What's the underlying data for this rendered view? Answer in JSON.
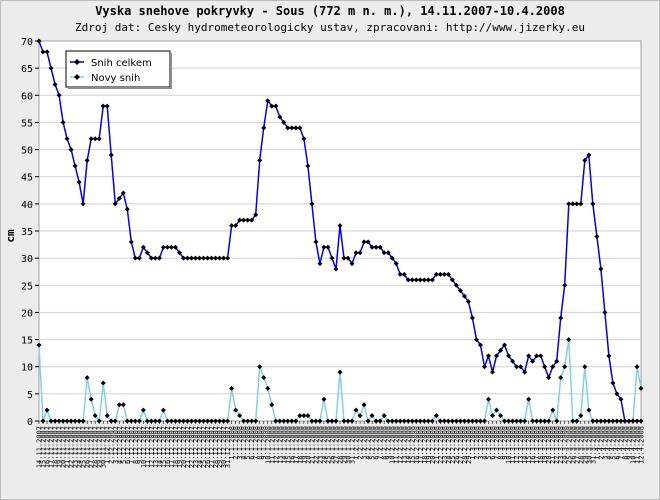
{
  "chart_data": {
    "type": "line",
    "title": "Vyska snehove pokryvky - Sous (772 m n. m.), 14.11.2007-10.4.2008",
    "subtitle": "Zdroj dat: Cesky hydrometeorologicky ustav, zpracovani: http://www.jizerky.eu",
    "ylabel": "cm",
    "xlabel": "",
    "ylim": [
      0,
      70
    ],
    "yticks": [
      0,
      5,
      10,
      15,
      20,
      25,
      30,
      35,
      40,
      45,
      50,
      55,
      60,
      65,
      70
    ],
    "grid": true,
    "legend_position": "top-left",
    "x_start": "14.11.2007",
    "x_end": "10.4.2008",
    "x_label_first": "14.11.2007",
    "x_label_last": "10.4.2008",
    "colors": {
      "snih_celkem": "#0000ee",
      "novy_snih": "#87ceeb",
      "marker": "#000000",
      "grid": "#d0d0d0",
      "plot_bg": "#ffffff",
      "frame_bg": "#ececec"
    },
    "series": [
      {
        "name": "Snih celkem",
        "values": [
          70,
          68,
          68,
          65,
          62,
          60,
          55,
          52,
          50,
          47,
          44,
          40,
          48,
          52,
          52,
          52,
          58,
          58,
          49,
          40,
          41,
          42,
          39,
          33,
          30,
          30,
          32,
          31,
          30,
          30,
          30,
          32,
          32,
          32,
          32,
          31,
          30,
          30,
          30,
          30,
          30,
          30,
          30,
          30,
          30,
          30,
          30,
          30,
          36,
          36,
          37,
          37,
          37,
          37,
          38,
          48,
          54,
          59,
          58,
          58,
          56,
          55,
          54,
          54,
          54,
          54,
          52,
          47,
          40,
          33,
          29,
          32,
          32,
          30,
          28,
          36,
          30,
          30,
          29,
          31,
          31,
          33,
          33,
          32,
          32,
          32,
          31,
          31,
          30,
          29,
          27,
          27,
          26,
          26,
          26,
          26,
          26,
          26,
          26,
          27,
          27,
          27,
          27,
          26,
          25,
          24,
          23,
          22,
          19,
          15,
          14,
          10,
          12,
          9,
          12,
          13,
          14,
          12,
          11,
          10,
          10,
          9,
          12,
          11,
          12,
          12,
          10,
          8,
          10,
          11,
          19,
          25,
          40,
          40,
          40,
          40,
          48,
          49,
          40,
          34,
          28,
          20,
          12,
          7,
          5,
          4,
          0,
          0,
          0,
          0,
          0
        ]
      },
      {
        "name": "Novy snih",
        "values": [
          14,
          0,
          2,
          0,
          0,
          0,
          0,
          0,
          0,
          0,
          0,
          0,
          8,
          4,
          1,
          0,
          7,
          1,
          0,
          0,
          3,
          3,
          0,
          0,
          0,
          0,
          2,
          0,
          0,
          0,
          0,
          2,
          0,
          0,
          0,
          0,
          0,
          0,
          0,
          0,
          0,
          0,
          0,
          0,
          0,
          0,
          0,
          0,
          6,
          2,
          1,
          0,
          0,
          0,
          0,
          10,
          8,
          6,
          3,
          0,
          0,
          0,
          0,
          0,
          0,
          1,
          1,
          1,
          0,
          0,
          0,
          4,
          0,
          0,
          0,
          9,
          0,
          0,
          0,
          2,
          1,
          3,
          0,
          1,
          0,
          0,
          1,
          0,
          0,
          0,
          0,
          0,
          0,
          0,
          0,
          0,
          0,
          0,
          0,
          1,
          0,
          0,
          0,
          0,
          0,
          0,
          0,
          0,
          0,
          0,
          0,
          0,
          4,
          1,
          2,
          1,
          0,
          0,
          0,
          0,
          0,
          0,
          4,
          0,
          0,
          0,
          0,
          0,
          2,
          0,
          8,
          10,
          15,
          0,
          0,
          1,
          10,
          2,
          0,
          0,
          0,
          0,
          0,
          0,
          0,
          0,
          0,
          0,
          0,
          10,
          6
        ]
      }
    ]
  }
}
